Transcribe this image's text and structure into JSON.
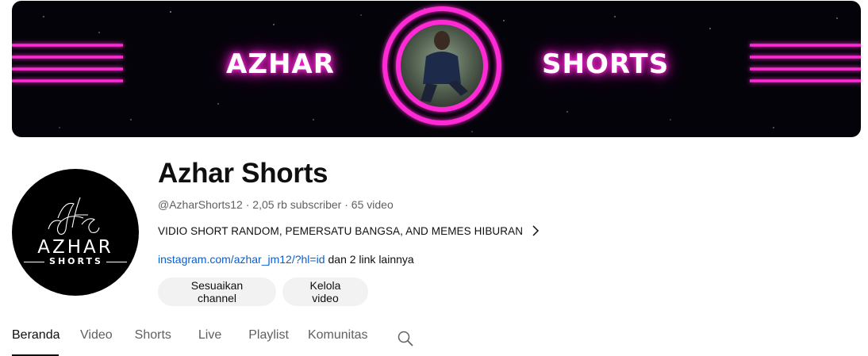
{
  "banner": {
    "left_text": "AZHAR",
    "right_text": "SHORTS",
    "neon_color": "#ff2bd6"
  },
  "avatar": {
    "word": "AZHAR",
    "subword": "SHORTS",
    "monogram": "Az"
  },
  "channel": {
    "title": "Azhar Shorts",
    "handle": "@AzharShorts12",
    "separator": " · ",
    "subscribers": "2,05 rb subscriber",
    "videos": "65 video",
    "description": "VIDIO SHORT RANDOM, PEMERSATU BANGSA, AND MEMES HIBURAN",
    "link": "instagram.com/azhar_jm12/?hl=id",
    "more_links": "dan 2 link lainnya"
  },
  "buttons": {
    "customize": "Sesuaikan channel",
    "manage": "Kelola video"
  },
  "tabs": [
    {
      "label": "Beranda",
      "active": true
    },
    {
      "label": "Video",
      "active": false
    },
    {
      "label": "Shorts",
      "active": false
    },
    {
      "label": "Live",
      "active": false
    },
    {
      "label": "Playlist",
      "active": false
    },
    {
      "label": "Komunitas",
      "active": false
    }
  ],
  "colors": {
    "link": "#065fd4",
    "button_bg": "#f2f2f2",
    "text_secondary": "#606060"
  }
}
